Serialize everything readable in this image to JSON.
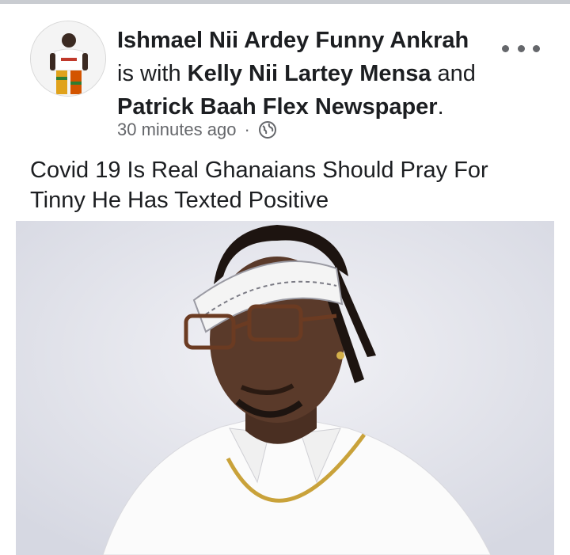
{
  "post": {
    "author": "Ishmael Nii Ardey Funny Ankrah",
    "with_text": "is with",
    "tagged_1": "Kelly Nii Lartey Mensa",
    "and_text": "and",
    "tagged_2": "Patrick Baah Flex Newspaper",
    "end_punct": ".",
    "timestamp": "30 minutes ago",
    "meta_separator": "·",
    "privacy_icon": "globe-icon",
    "more_icon": "more-options-icon",
    "text_line_1": "Covid 19 Is Real Ghanaians Should Pray For",
    "text_line_2": "Tinny He Has Texted Positive"
  },
  "colors": {
    "text_primary": "#1c1e21",
    "text_secondary": "#65676b",
    "photo_background": "#e6e7ee"
  }
}
